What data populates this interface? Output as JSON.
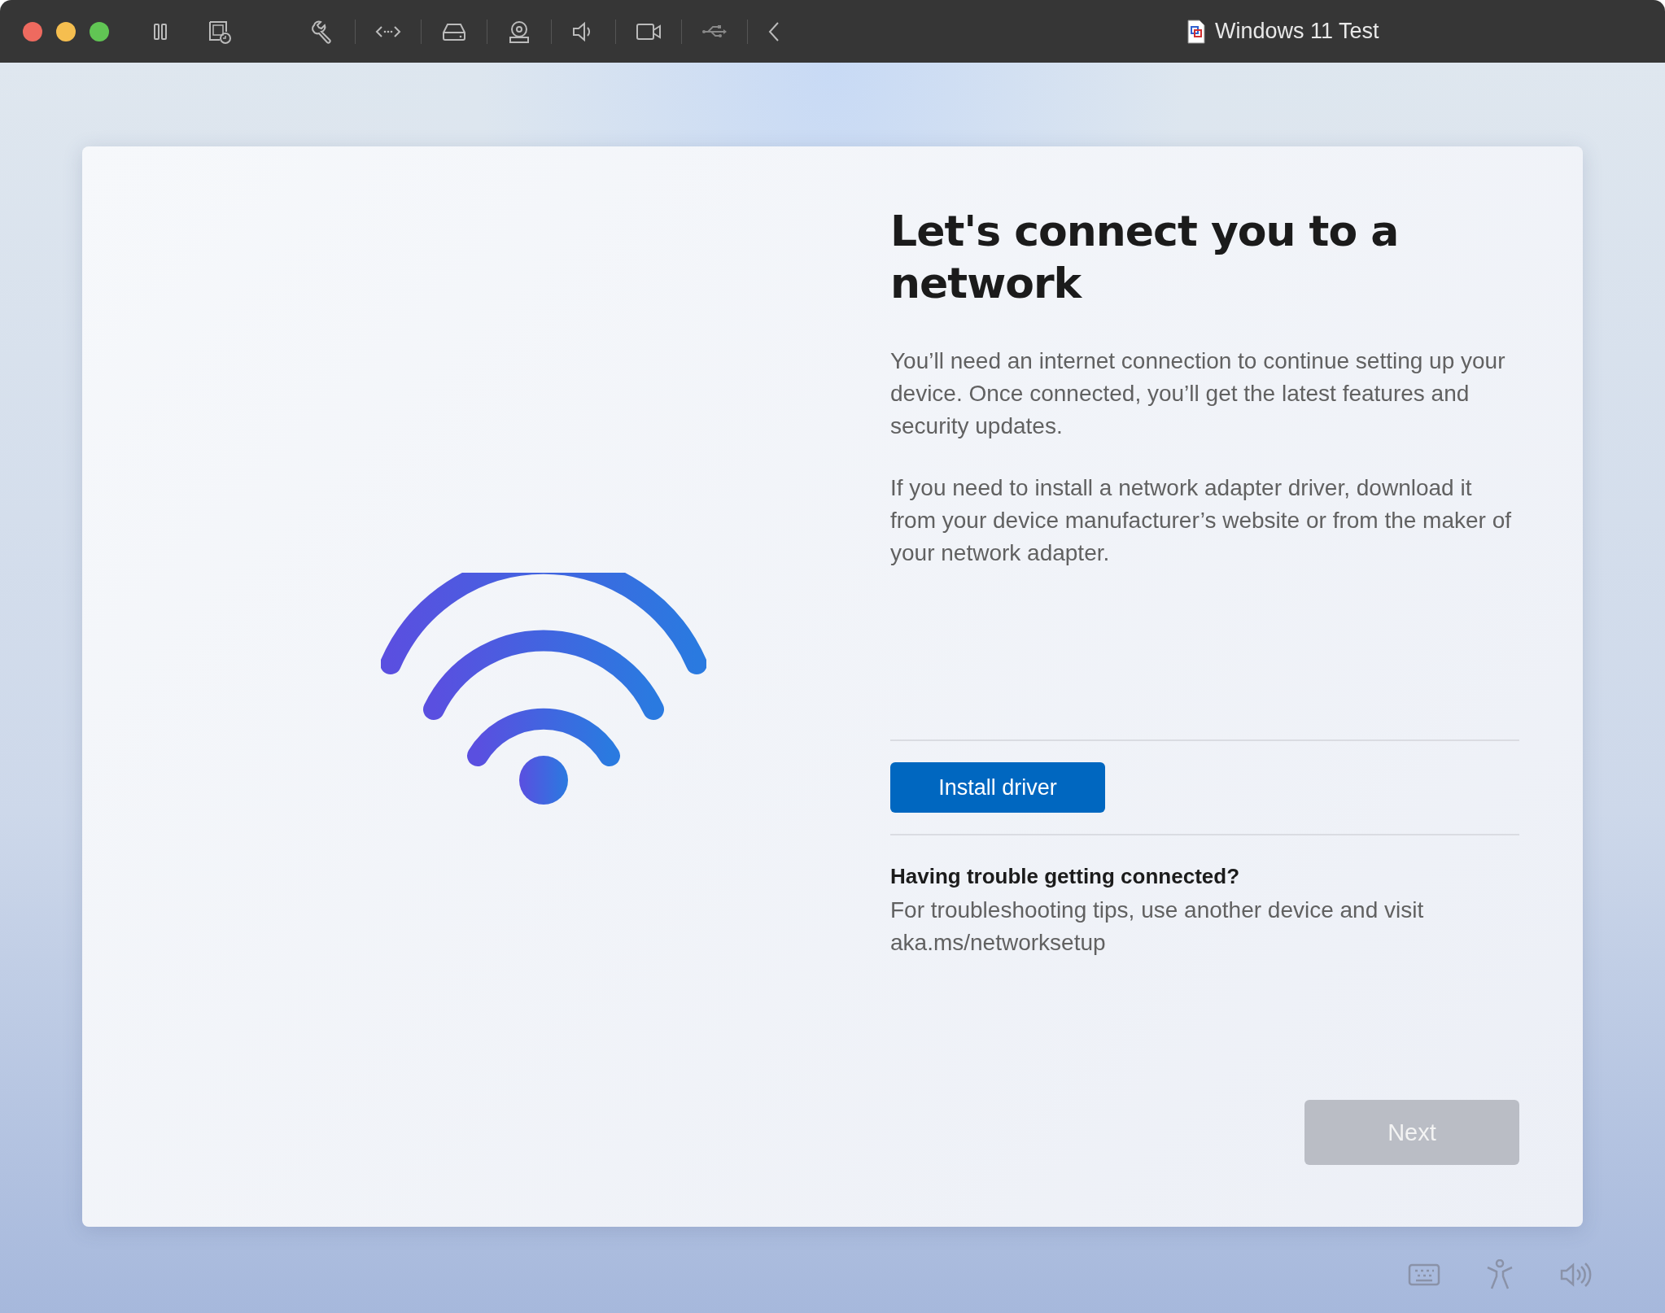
{
  "window": {
    "title": "Windows 11 Test"
  },
  "setup": {
    "heading": "Let's connect you to a network",
    "paragraphs": [
      "You’ll need an internet connection to continue setting up your device. Once connected, you’ll get the latest features and security updates.",
      "If you need to install a network adapter driver, download it from your device manufacturer’s website or from the maker of your network adapter."
    ],
    "install_button": {
      "label": "Install driver",
      "disabled": false
    },
    "help": {
      "title": "Having trouble getting connected?",
      "text": "For troubleshooting tips, use another device and visit aka.ms/networksetup"
    },
    "next_button": {
      "label": "Next",
      "disabled": true
    }
  }
}
